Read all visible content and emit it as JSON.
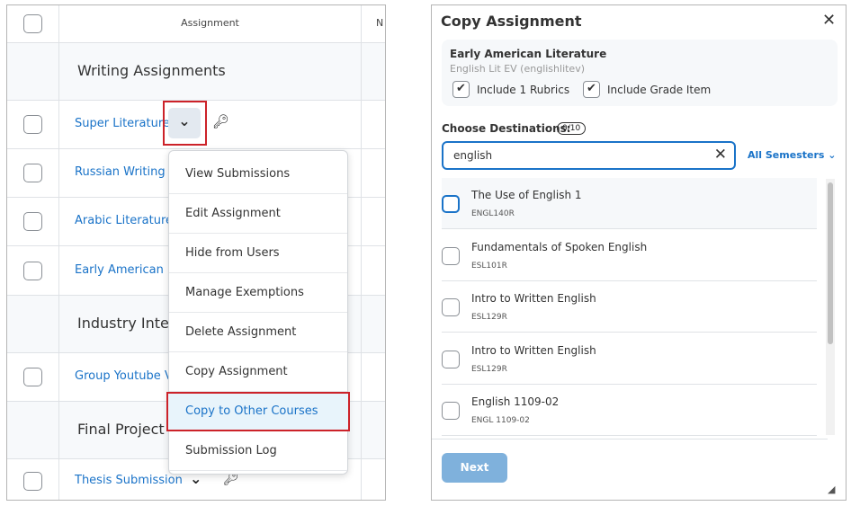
{
  "table": {
    "header": {
      "assignment": "Assignment",
      "next_col": "N"
    },
    "rows": [
      {
        "type": "section",
        "label": "Writing Assignments"
      },
      {
        "type": "item",
        "label": "Super Literature"
      },
      {
        "type": "item",
        "label": "Russian Writing S"
      },
      {
        "type": "item",
        "label": "Arabic Literature"
      },
      {
        "type": "item",
        "label": "Early American L"
      },
      {
        "type": "section",
        "label": "Industry Interv"
      },
      {
        "type": "item",
        "label": "Group Youtube V"
      },
      {
        "type": "section",
        "label": "Final Project"
      },
      {
        "type": "item",
        "label": "Thesis Submission"
      }
    ]
  },
  "context_menu": {
    "items": [
      "View Submissions",
      "Edit Assignment",
      "Hide from Users",
      "Manage Exemptions",
      "Delete Assignment",
      "Copy Assignment",
      "Copy to Other Courses",
      "Submission Log"
    ],
    "highlighted": "Copy to Other Courses"
  },
  "dialog": {
    "title": "Copy Assignment",
    "source": {
      "name": "Early American Literature",
      "course": "English Lit EV (englishlitev)",
      "include_rubrics": "Include 1 Rubrics",
      "include_grade": "Include Grade Item"
    },
    "choose_label": "Choose Destinations:",
    "count": "0/10",
    "search_value": "english",
    "semester_filter": "All Semesters",
    "results": [
      {
        "title": "The Use of English 1",
        "code": "ENGL140R"
      },
      {
        "title": "Fundamentals of Spoken English",
        "code": "ESL101R"
      },
      {
        "title": "Intro to Written English",
        "code": "ESL129R"
      },
      {
        "title": "Intro to Written English",
        "code": "ESL129R"
      },
      {
        "title": "English 1109-02",
        "code": "ENGL 1109-02"
      }
    ],
    "next_label": "Next"
  },
  "colors": {
    "link": "#1a73c8",
    "highlight_border": "#cc2229",
    "primary_disabled": "#7fb1dc"
  }
}
